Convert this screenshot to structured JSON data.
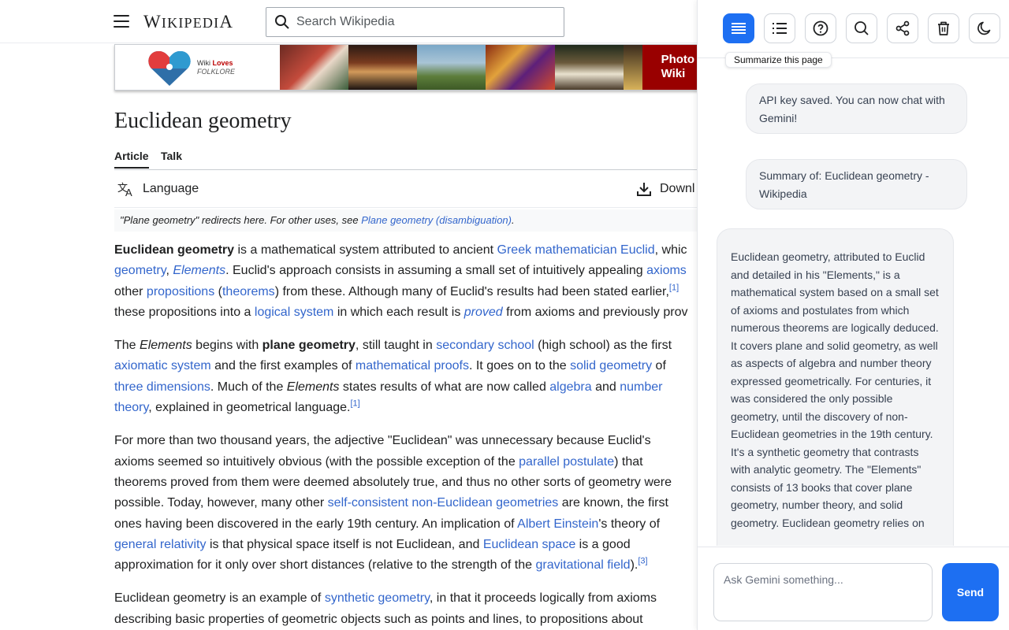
{
  "wiki": {
    "wordmark": "Wikipedia",
    "search": {
      "placeholder": "Search Wikipedia"
    },
    "banner": {
      "logo_line1_a": "Wiki ",
      "logo_line1_b": "Loves",
      "logo_line2": "FOLKLORE",
      "cta": "Photo\nWiki"
    },
    "title": "Euclidean geometry",
    "tabs": [
      "Article",
      "Talk"
    ],
    "language_label": "Language",
    "download_label": "Downl",
    "hatnote": {
      "prefix": "\"Plane geometry\" redirects here. For other uses, see ",
      "link": "Plane geometry (disambiguation)",
      "suffix": "."
    },
    "paragraphs": [
      [
        [
          {
            "t": "Euclidean geometry",
            "s": "b"
          },
          {
            "t": " is a mathematical system attributed to ancient "
          },
          {
            "t": "Greek mathematician Euclid",
            "s": "a"
          },
          {
            "t": ", whic"
          }
        ],
        [
          {
            "t": "geometry",
            "s": "a"
          },
          {
            "t": ", "
          },
          {
            "t": "Elements",
            "s": "ai"
          },
          {
            "t": ". Euclid's approach consists in assuming a small set of intuitively appealing "
          },
          {
            "t": "axioms",
            "s": "a"
          }
        ],
        [
          {
            "t": "other "
          },
          {
            "t": "propositions",
            "s": "a"
          },
          {
            "t": " ("
          },
          {
            "t": "theorems",
            "s": "a"
          },
          {
            "t": ") from these. Although many of Euclid's results had been stated earlier,"
          },
          {
            "t": "[1]",
            "s": "sup"
          }
        ],
        [
          {
            "t": "these propositions into a "
          },
          {
            "t": "logical system",
            "s": "a"
          },
          {
            "t": " in which each result is "
          },
          {
            "t": "proved",
            "s": "ai"
          },
          {
            "t": " from axioms and previously prov"
          }
        ]
      ],
      [
        [
          {
            "t": "The "
          },
          {
            "t": "Elements",
            "s": "i"
          },
          {
            "t": " begins with "
          },
          {
            "t": "plane geometry",
            "s": "b"
          },
          {
            "t": ", still taught in "
          },
          {
            "t": "secondary school",
            "s": "a"
          },
          {
            "t": " (high school) as the first"
          }
        ],
        [
          {
            "t": "axiomatic system",
            "s": "a"
          },
          {
            "t": " and the first examples of "
          },
          {
            "t": "mathematical proofs",
            "s": "a"
          },
          {
            "t": ". It goes on to the "
          },
          {
            "t": "solid geometry",
            "s": "a"
          },
          {
            "t": " of"
          }
        ],
        [
          {
            "t": "three dimensions",
            "s": "a"
          },
          {
            "t": ". Much of the "
          },
          {
            "t": "Elements",
            "s": "i"
          },
          {
            "t": " states results of what are now called "
          },
          {
            "t": "algebra",
            "s": "a"
          },
          {
            "t": " and "
          },
          {
            "t": "number",
            "s": "a"
          }
        ],
        [
          {
            "t": "theory",
            "s": "a"
          },
          {
            "t": ", explained in geometrical language."
          },
          {
            "t": "[1]",
            "s": "sup"
          }
        ]
      ],
      [
        [
          {
            "t": "For more than two thousand years, the adjective \"Euclidean\" was unnecessary because Euclid's"
          }
        ],
        [
          {
            "t": "axioms seemed so intuitively obvious (with the possible exception of the "
          },
          {
            "t": "parallel postulate",
            "s": "a"
          },
          {
            "t": ") that"
          }
        ],
        [
          {
            "t": "theorems proved from them were deemed absolutely true, and thus no other sorts of geometry were"
          }
        ],
        [
          {
            "t": "possible. Today, however, many other "
          },
          {
            "t": "self-consistent",
            "s": "a"
          },
          {
            "t": " "
          },
          {
            "t": "non-Euclidean geometries",
            "s": "a"
          },
          {
            "t": " are known, the first"
          }
        ],
        [
          {
            "t": "ones having been discovered in the early 19th century. An implication of "
          },
          {
            "t": "Albert Einstein",
            "s": "a"
          },
          {
            "t": "'s theory of"
          }
        ],
        [
          {
            "t": "general relativity",
            "s": "a"
          },
          {
            "t": " is that physical space itself is not Euclidean, and "
          },
          {
            "t": "Euclidean space",
            "s": "a"
          },
          {
            "t": " is a good"
          }
        ],
        [
          {
            "t": "approximation for it only over short distances (relative to the strength of the "
          },
          {
            "t": "gravitational field",
            "s": "a"
          },
          {
            "t": ")."
          },
          {
            "t": "[3]",
            "s": "sup"
          }
        ]
      ],
      [
        [
          {
            "t": "Euclidean geometry is an example of "
          },
          {
            "t": "synthetic geometry",
            "s": "a"
          },
          {
            "t": ", in that it proceeds logically from axioms"
          }
        ],
        [
          {
            "t": "describing basic properties of geometric objects such as points and lines, to propositions about"
          }
        ]
      ]
    ]
  },
  "panel": {
    "toolbar": [
      {
        "name": "summarize",
        "icon": "summarize-icon",
        "active": true
      },
      {
        "name": "outline",
        "icon": "list-icon",
        "active": false
      },
      {
        "name": "help",
        "icon": "help-icon",
        "active": false
      },
      {
        "name": "search",
        "icon": "search-icon",
        "active": false
      },
      {
        "name": "share",
        "icon": "share-icon",
        "active": false
      },
      {
        "name": "delete",
        "icon": "trash-icon",
        "active": false
      },
      {
        "name": "theme",
        "icon": "moon-icon",
        "active": false
      }
    ],
    "tooltip": "Summarize this page",
    "messages": [
      "API key saved. You can now chat with Gemini!",
      "Summary of: Euclidean geometry - Wikipedia",
      "Euclidean geometry, attributed to Euclid and detailed in his \"Elements,\" is a mathematical system based on a small set of axioms and postulates from which numerous theorems are logically deduced. It covers plane and solid geometry, as well as aspects of algebra and number theory expressed geometrically. For centuries, it was considered the only possible geometry, until the discovery of non-Euclidean geometries in the 19th century. It's a synthetic geometry that contrasts with analytic geometry. The \"Elements\" consists of 13 books that cover plane geometry, number theory, and solid geometry. Euclidean geometry relies on"
    ],
    "input": {
      "placeholder": "Ask Gemini something..."
    },
    "send_label": "Send",
    "accent_color": "#1d6ff2"
  }
}
